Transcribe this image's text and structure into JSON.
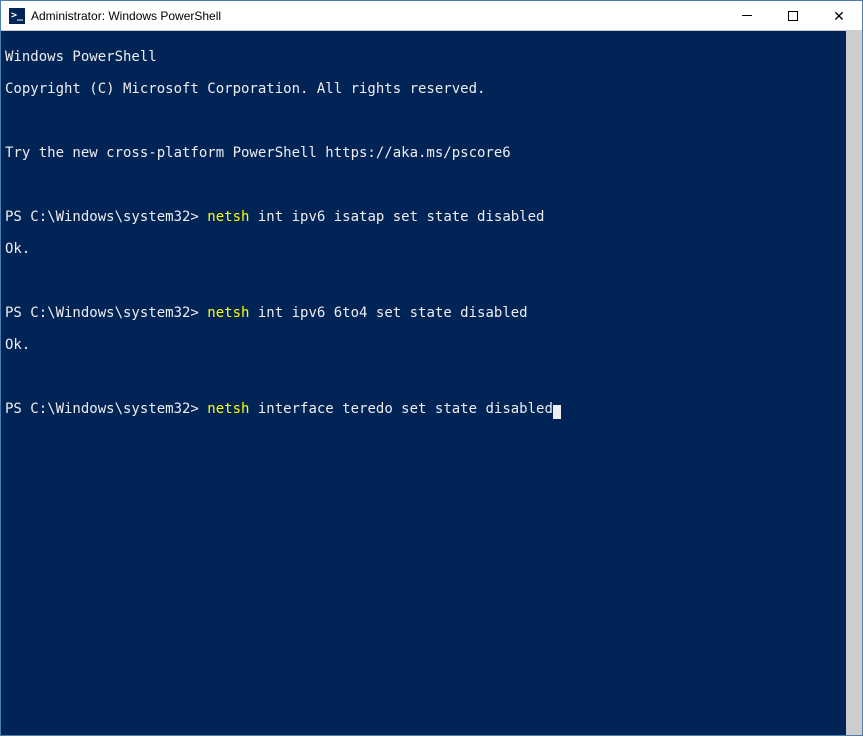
{
  "window": {
    "title": "Administrator: Windows PowerShell"
  },
  "terminal": {
    "banner_line1": "Windows PowerShell",
    "banner_line2": "Copyright (C) Microsoft Corporation. All rights reserved.",
    "banner_line3": "Try the new cross-platform PowerShell https://aka.ms/pscore6",
    "prompt": "PS C:\\Windows\\system32> ",
    "cmd_highlight": "netsh",
    "entries": [
      {
        "cmd_rest": " int ipv6 isatap set state disabled",
        "output": "Ok."
      },
      {
        "cmd_rest": " int ipv6 6to4 set state disabled",
        "output": "Ok."
      }
    ],
    "current_cmd_rest": " interface teredo set state disabled"
  }
}
